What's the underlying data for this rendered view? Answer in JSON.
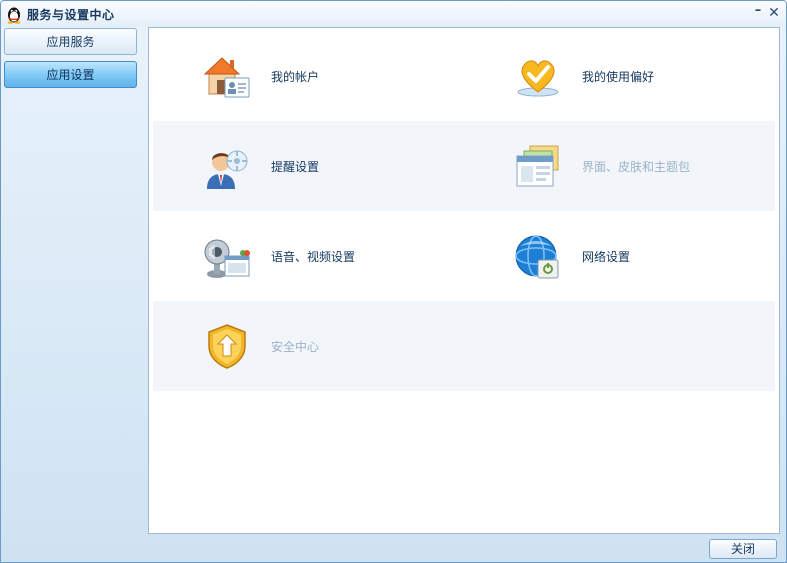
{
  "window": {
    "title": "服务与设置中心",
    "minimize_glyph": "–",
    "close_glyph": "✕"
  },
  "sidebar": {
    "items": [
      {
        "label": "应用服务",
        "active": false
      },
      {
        "label": "应用设置",
        "active": true
      }
    ]
  },
  "settings": {
    "items": [
      {
        "label": "我的帐户",
        "icon": "house-account-icon",
        "enabled": true
      },
      {
        "label": "我的使用偏好",
        "icon": "heart-preferences-icon",
        "enabled": true
      },
      {
        "label": "提醒设置",
        "icon": "person-reminder-icon",
        "enabled": true
      },
      {
        "label": "界面、皮肤和主题包",
        "icon": "window-skin-icon",
        "enabled": false
      },
      {
        "label": "语音、视频设置",
        "icon": "camera-av-icon",
        "enabled": true
      },
      {
        "label": "网络设置",
        "icon": "globe-network-icon",
        "enabled": true
      },
      {
        "label": "安全中心",
        "icon": "shield-security-icon",
        "enabled": false
      }
    ]
  },
  "footer": {
    "close_label": "关闭"
  },
  "colors": {
    "accent": "#5fb3ee",
    "panel_border": "#9cbad6",
    "disabled_text": "#9db3c7"
  }
}
